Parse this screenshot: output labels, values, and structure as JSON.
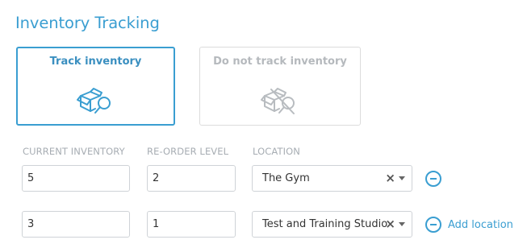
{
  "section": {
    "title": "Inventory Tracking"
  },
  "options": {
    "track": {
      "label": "Track inventory",
      "icon": "box-search-icon",
      "selected": true
    },
    "no_track": {
      "label": "Do not track inventory",
      "icon": "box-search-off-icon",
      "selected": false
    }
  },
  "columns": {
    "current_inventory": "CURRENT INVENTORY",
    "reorder_level": "RE-ORDER LEVEL",
    "location": "LOCATION"
  },
  "rows": [
    {
      "current_inventory": "5",
      "reorder_level": "2",
      "location": "The Gym"
    },
    {
      "current_inventory": "3",
      "reorder_level": "1",
      "location": "Test and Training Studio"
    }
  ],
  "actions": {
    "add_location": "Add location"
  },
  "colors": {
    "accent": "#3a9ed1",
    "muted": "#a7adb3"
  }
}
